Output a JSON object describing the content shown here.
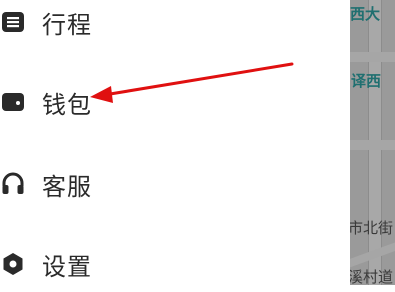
{
  "drawer": {
    "items": [
      {
        "label": "行程",
        "icon": "trip-list-icon"
      },
      {
        "label": "钱包",
        "icon": "wallet-icon"
      },
      {
        "label": "客服",
        "icon": "headset-icon"
      },
      {
        "label": "设置",
        "icon": "gear-icon"
      }
    ]
  },
  "map": {
    "labels": [
      "西大",
      "译西",
      "市北街",
      "溪村道"
    ]
  },
  "colors": {
    "icon": "#2a2a2a",
    "annotation_arrow": "#e01010",
    "map_label_teal": "#1f6f70"
  }
}
